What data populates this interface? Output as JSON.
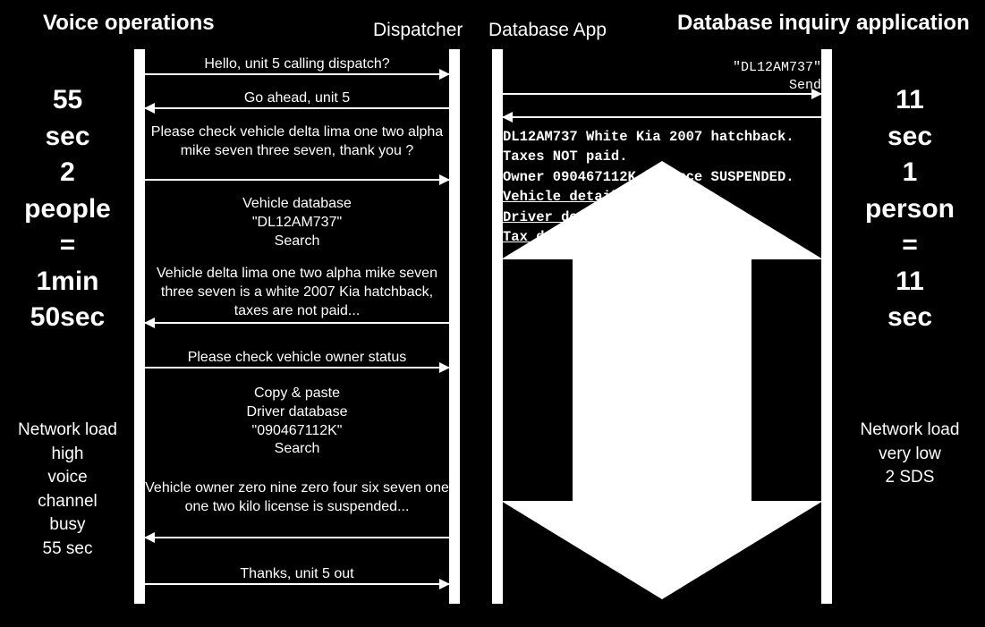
{
  "headers": {
    "voice_ops": "Voice operations",
    "dispatcher": "Dispatcher",
    "db_app": "Database App",
    "db_inquiry": "Database inquiry application"
  },
  "left_stats": {
    "l1": "55",
    "l2": "sec",
    "l3": "2",
    "l4": "people",
    "l5": "=",
    "l6": "1min",
    "l7": "50sec"
  },
  "left_note": {
    "l1": "Network load",
    "l2": "high",
    "l3": "voice",
    "l4": "channel",
    "l5": "busy",
    "l6": "55 sec"
  },
  "right_stats": {
    "l1": "11",
    "l2": "sec",
    "l3": "1",
    "l4": "person",
    "l5": "=",
    "l6": "11",
    "l7": "sec"
  },
  "right_note": {
    "l1": "Network load",
    "l2": "very low",
    "l3": "2 SDS"
  },
  "voice_msgs": {
    "m1": "Hello, unit 5 calling dispatch?",
    "m2": "Go ahead, unit 5",
    "m3": "Please check vehicle delta lima one two alpha mike seven three seven, thank you ?",
    "m4": "Vehicle database\n\"DL12AM737\"\nSearch",
    "m5": "Vehicle delta lima one two alpha mike seven three seven is a white 2007 Kia hatchback, taxes are not paid...",
    "m6": "Please check vehicle owner status",
    "m7": "Copy & paste\nDriver database\n\"090467112K\"\nSearch",
    "m8": "Vehicle owner zero nine zero four six seven one one two kilo license is suspended...",
    "m9": "Thanks, unit 5 out"
  },
  "db_msgs": {
    "send_plate": "\"DL12AM737\"",
    "send_label": "Send"
  },
  "db_output": {
    "l1": "DL12AM737 White Kia 2007 hatchback.",
    "l2": "Taxes NOT paid.",
    "l3": "Owner 090467112K licence SUSPENDED.",
    "link1": "Vehicle details",
    "link2": "Driver det",
    "link3": "Tax d"
  }
}
